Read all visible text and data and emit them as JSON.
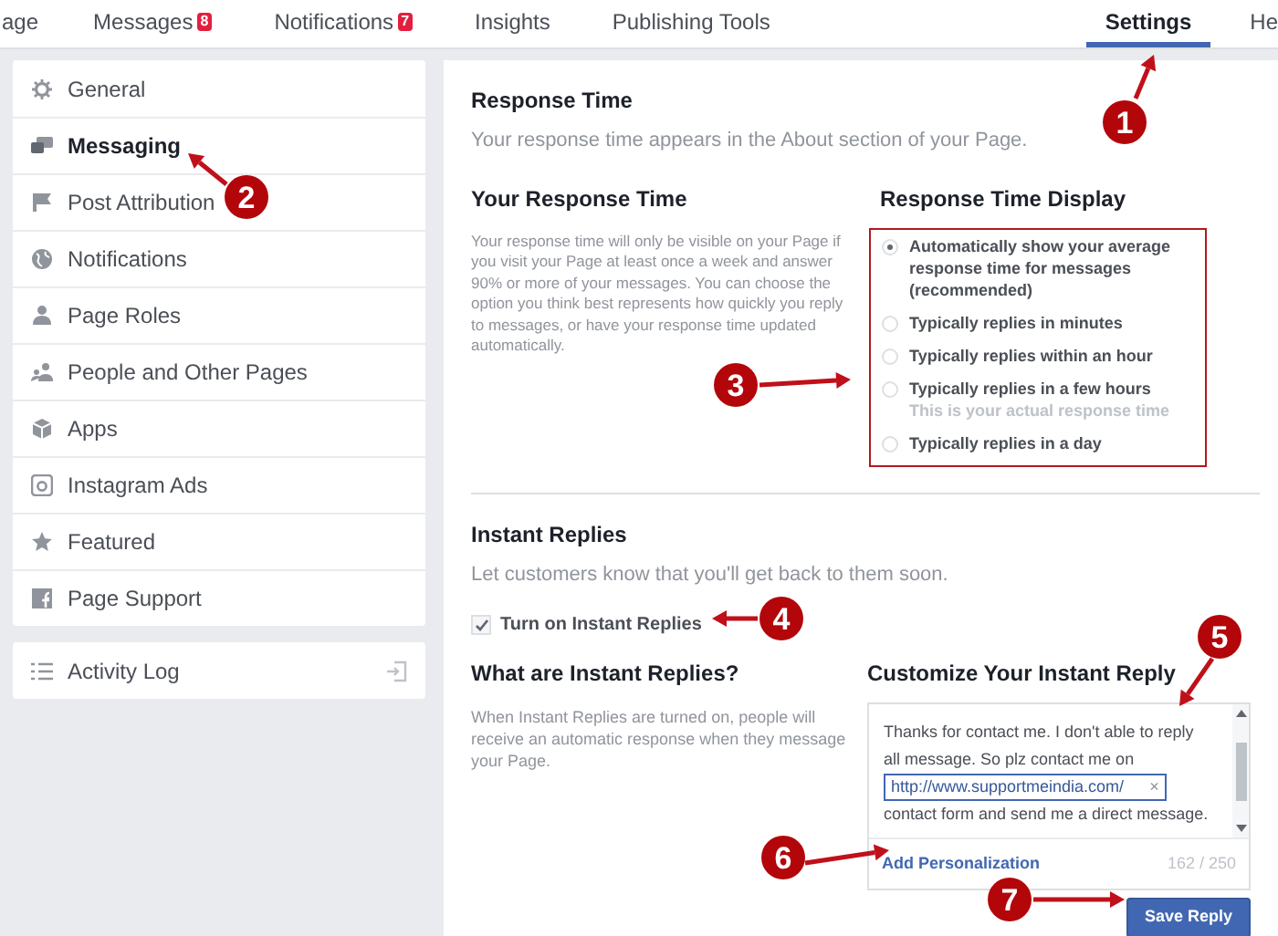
{
  "nav": {
    "left_tabs": [
      {
        "label": "age",
        "selected": false
      },
      {
        "label": "Messages",
        "badge": "8",
        "selected": false
      },
      {
        "label": "Notifications",
        "badge": "7",
        "selected": false
      },
      {
        "label": "Insights",
        "selected": false
      },
      {
        "label": "Publishing Tools",
        "selected": false
      }
    ],
    "right_tabs": [
      {
        "label": "Settings",
        "selected": true
      },
      {
        "label": "He",
        "selected": false
      }
    ]
  },
  "sidebar": {
    "items": [
      {
        "label": "General",
        "selected": false
      },
      {
        "label": "Messaging",
        "selected": true
      },
      {
        "label": "Post Attribution",
        "selected": false
      },
      {
        "label": "Notifications",
        "selected": false
      },
      {
        "label": "Page Roles",
        "selected": false
      },
      {
        "label": "People and Other Pages",
        "selected": false
      },
      {
        "label": "Apps",
        "selected": false
      },
      {
        "label": "Instagram Ads",
        "selected": false
      },
      {
        "label": "Featured",
        "selected": false
      },
      {
        "label": "Page Support",
        "selected": false
      }
    ],
    "activity_log": {
      "label": "Activity Log"
    }
  },
  "response_time": {
    "title": "Response Time",
    "subtitle": "Your response time appears in the About section of your Page.",
    "left_heading": "Your Response Time",
    "left_text": "Your response time will only be visible on your Page if you visit your Page at least once a week and answer 90% or more of your messages. You can choose the option you think best represents how quickly you reply to messages, or have your response time updated automatically.",
    "right_heading": "Response Time Display",
    "options": [
      {
        "label": "Automatically show your average response time for messages (recommended)",
        "selected": true
      },
      {
        "label": "Typically replies in minutes",
        "selected": false
      },
      {
        "label": "Typically replies within an hour",
        "selected": false
      },
      {
        "label": "Typically replies in a few hours",
        "note": "This is your actual response time",
        "selected": false
      },
      {
        "label": "Typically replies in a day",
        "selected": false
      }
    ]
  },
  "instant_replies": {
    "title": "Instant Replies",
    "subtitle": "Let customers know that you'll get back to them soon.",
    "toggle": {
      "label": "Turn on Instant Replies",
      "checked": true
    },
    "left_heading": "What are Instant Replies?",
    "left_text": "When Instant Replies are turned on, people will receive an automatic response when they message your Page.",
    "right_heading": "Customize Your Instant Reply",
    "reply_lines": [
      "Thanks for contact me. I don't able to reply",
      "all message. So plz contact me on"
    ],
    "reply_link": "http://www.supportmeindia.com/",
    "reply_link_remove": "×",
    "reply_end": "contact form and send me a direct message.",
    "personalization": "Add Personalization",
    "counter": "162 / 250",
    "save_button": "Save Reply"
  },
  "annotations": [
    {
      "label": "1"
    },
    {
      "label": "2"
    },
    {
      "label": "3"
    },
    {
      "label": "4"
    },
    {
      "label": "5"
    },
    {
      "label": "6"
    },
    {
      "label": "7"
    }
  ]
}
